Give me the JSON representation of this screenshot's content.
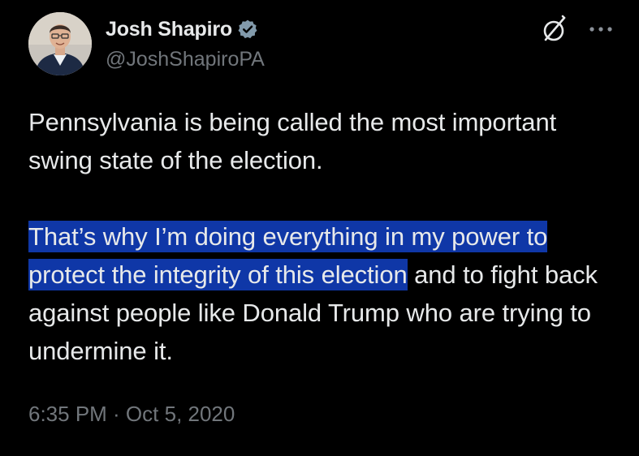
{
  "author": {
    "display_name": "Josh Shapiro",
    "handle": "@JoshShapiroPA",
    "verified_icon": "verified-badge-icon",
    "avatar_icon": "profile-photo"
  },
  "actions": {
    "grok_icon": "grok-icon",
    "more_icon": "more-options-icon"
  },
  "tweet": {
    "paragraph1": "Pennsylvania is being called the most important swing state of the election.",
    "paragraph2_highlighted": "That’s why I’m doing everything in my power to protect the integrity of this election",
    "paragraph2_rest": " and to fight back against people like Donald Trump who are trying to undermine it.",
    "timestamp": "6:35 PM · Oct 5, 2020"
  },
  "colors": {
    "background": "#000000",
    "text": "#e7e9ea",
    "secondary": "#71767b",
    "selection": "#0f37a7"
  }
}
